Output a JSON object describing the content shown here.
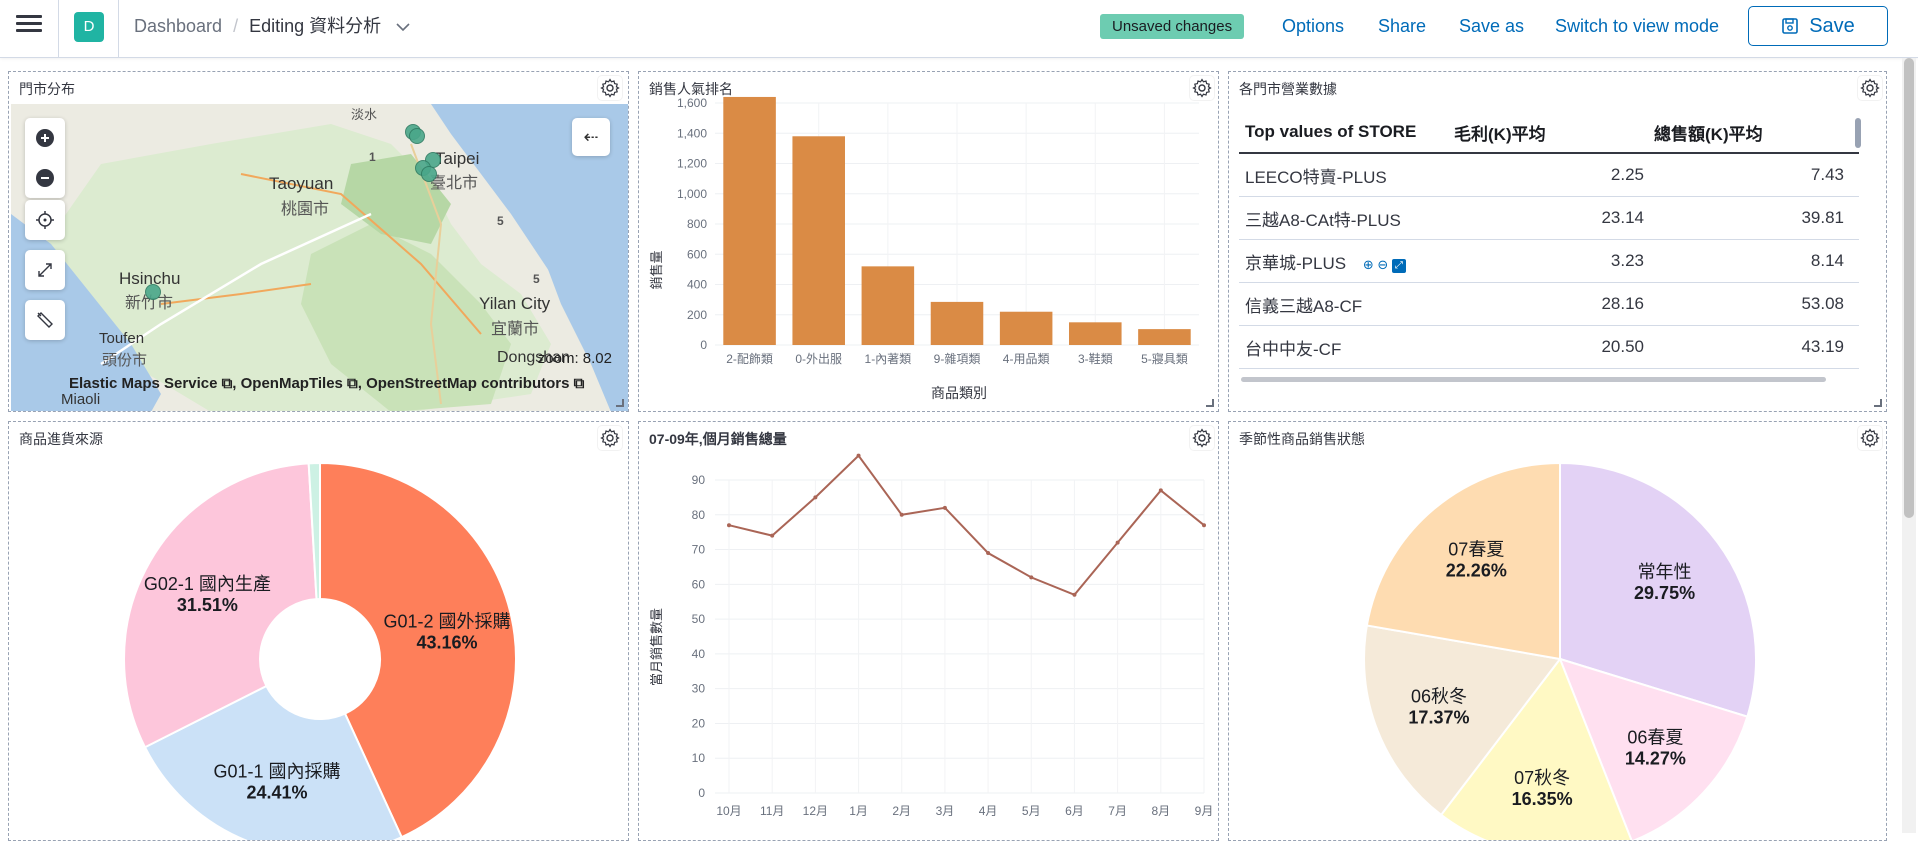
{
  "header": {
    "space_initial": "D",
    "breadcrumb_root": "Dashboard",
    "breadcrumb_separator": "/",
    "breadcrumb_current": "Editing 資料分析",
    "unsaved_badge": "Unsaved changes",
    "options": "Options",
    "share": "Share",
    "save_as": "Save as",
    "switch_view": "Switch to view mode",
    "save": "Save"
  },
  "panels": {
    "map": {
      "title": "門市分布",
      "attribution": "Elastic Maps Service ⧉, OpenMapTiles ⧉, OpenStreetMap contributors ⧉",
      "zoom_label": "zoom: 8.02",
      "labels": {
        "taipei": "Taipei",
        "taipei_zh": "臺北市",
        "taoyuan": "Taoyuan",
        "taoyuan_zh": "桃園市",
        "hsinchu": "Hsinchu",
        "hsinchu_zh": "新竹市",
        "toufen": "Toufen",
        "toufen_zh": "頭份市",
        "yilan": "Yilan City",
        "yilan_zh": "宜蘭市",
        "dongshan": "Dongshan",
        "miaoli": "Miaoli",
        "tamsui": "淡水"
      },
      "road_numbers": [
        "1",
        "5",
        "5"
      ]
    },
    "bar": {
      "title": "銷售人氣排名",
      "ylabel": "銷售量",
      "xlabel": "商品類別"
    },
    "table": {
      "title": "各門市營業數據",
      "columns": [
        "Top values of STORE",
        "毛利(K)平均",
        "總售額(K)平均"
      ],
      "rows": [
        [
          "LEECO特賣-PLUS",
          "2.25",
          "7.43"
        ],
        [
          "三越A8-CAt特-PLUS",
          "23.14",
          "39.81"
        ],
        [
          "京華城-PLUS",
          "3.23",
          "8.14"
        ],
        [
          "信義三越A8-CF",
          "28.16",
          "53.08"
        ],
        [
          "台中中友-CF",
          "20.50",
          "43.19"
        ]
      ],
      "cell_actions": [
        "⊕",
        "⊖",
        "⤢"
      ]
    },
    "donut": {
      "title": "商品進貨來源"
    },
    "line": {
      "title": "07-09年,個月銷售總量",
      "ylabel": "當月銷售數量"
    },
    "pie": {
      "title": "季節性商品銷售狀態"
    }
  },
  "chart_data": [
    {
      "type": "bar",
      "title": "",
      "xlabel": "商品類別",
      "ylabel": "銷售量",
      "categories": [
        "2-配飾類",
        "0-外出服",
        "1-內著類",
        "9-雜項類",
        "4-用品類",
        "3-鞋類",
        "5-寢具類"
      ],
      "values": [
        1640,
        1380,
        520,
        285,
        220,
        150,
        105
      ],
      "ylim": [
        0,
        1600
      ],
      "yticks": [
        0,
        200,
        400,
        600,
        800,
        1000,
        1200,
        1400,
        1600
      ],
      "color": "#da8b45",
      "grid": true
    },
    {
      "type": "pie",
      "donut": true,
      "title": "",
      "slices": [
        {
          "label": "G01-2 國外採購",
          "value": 43.16,
          "pct": "43.16%",
          "color": "#fe7f5a"
        },
        {
          "label": "G01-1 國內採購",
          "value": 24.41,
          "pct": "24.41%",
          "color": "#cbe1f7"
        },
        {
          "label": "G02-1 國內生產",
          "value": 31.51,
          "pct": "31.51%",
          "color": "#fdc6db"
        },
        {
          "label": "",
          "value": 0.92,
          "pct": "",
          "color": "#cdf1e4"
        }
      ]
    },
    {
      "type": "line",
      "title": "",
      "xlabel": "",
      "ylabel": "當月銷售數量",
      "categories": [
        "10月",
        "11月",
        "12月",
        "1月",
        "2月",
        "3月",
        "4月",
        "5月",
        "6月",
        "7月",
        "8月",
        "9月"
      ],
      "values": [
        77,
        74,
        85,
        97,
        80,
        82,
        69,
        62,
        57,
        72,
        87,
        77
      ],
      "ylim": [
        0,
        90
      ],
      "yticks": [
        0,
        10,
        20,
        30,
        40,
        50,
        60,
        70,
        80,
        90
      ],
      "color": "#aa6556",
      "grid": true
    },
    {
      "type": "pie",
      "title": "",
      "slices": [
        {
          "label": "常年性",
          "value": 29.75,
          "pct": "29.75%",
          "color": "#e3d2f5"
        },
        {
          "label": "06春夏",
          "value": 14.27,
          "pct": "14.27%",
          "color": "#ffe0f0"
        },
        {
          "label": "07秋冬",
          "value": 16.35,
          "pct": "16.35%",
          "color": "#fff9c4"
        },
        {
          "label": "06秋冬",
          "value": 17.37,
          "pct": "17.37%",
          "color": "#f5ead9"
        },
        {
          "label": "07春夏",
          "value": 22.26,
          "pct": "22.26%",
          "color": "#fedcb1"
        }
      ]
    }
  ]
}
